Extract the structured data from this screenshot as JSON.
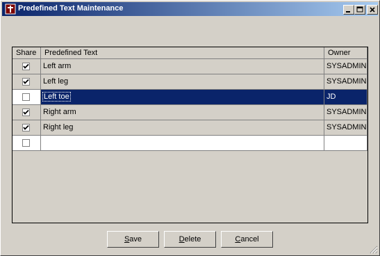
{
  "window": {
    "title": "Predefined Text Maintenance",
    "buttons": [
      "minimize-icon",
      "maximize-icon",
      "close-icon"
    ]
  },
  "grid": {
    "columns": [
      "Share",
      "Predefined Text",
      "Owner"
    ],
    "rows": [
      {
        "share": true,
        "text": "Left arm",
        "owner": "SYSADMIN"
      },
      {
        "share": true,
        "text": "Left leg",
        "owner": "SYSADMIN"
      },
      {
        "share": false,
        "text": "Left toe",
        "owner": "JD",
        "selected": true
      },
      {
        "share": true,
        "text": "Right arm",
        "owner": "SYSADMIN"
      },
      {
        "share": true,
        "text": "Right leg",
        "owner": "SYSADMIN"
      },
      {
        "share": false,
        "text": "",
        "owner": ""
      }
    ]
  },
  "actions": {
    "save": {
      "first": "S",
      "rest": "ave"
    },
    "delete": {
      "first": "D",
      "rest": "elete"
    },
    "cancel": {
      "first": "C",
      "rest": "ancel"
    }
  },
  "colors": {
    "selection": "#0a246a",
    "face": "#d4d0c8"
  }
}
